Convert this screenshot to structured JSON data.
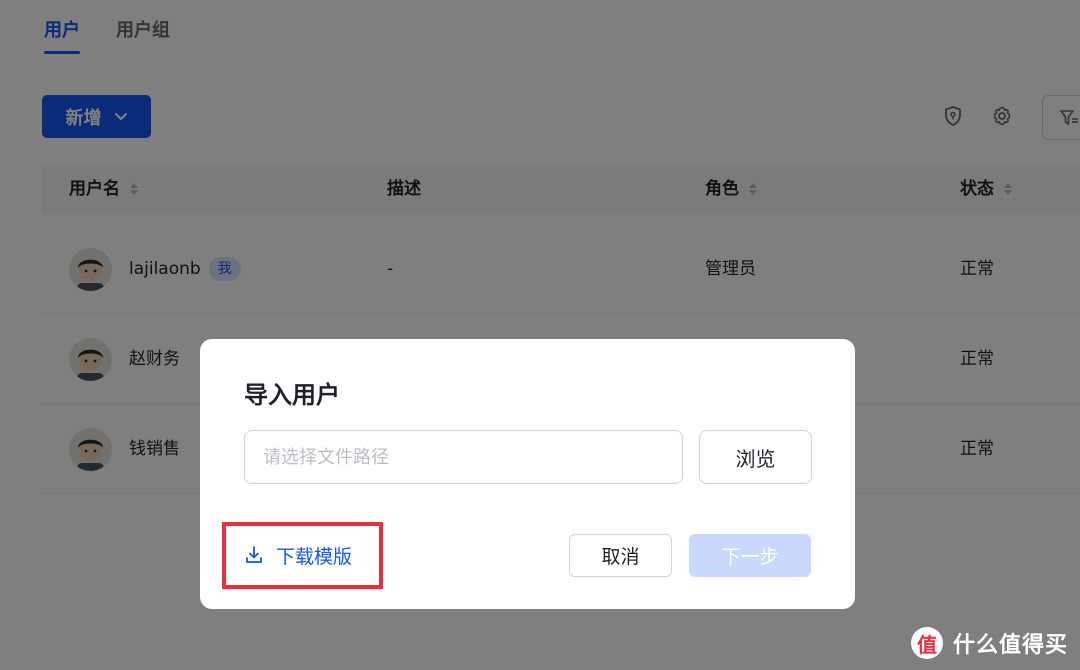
{
  "tabs": [
    {
      "label": "用户"
    },
    {
      "label": "用户组"
    }
  ],
  "toolbar": {
    "add_label": "新增",
    "icons": [
      "shield-icon",
      "gear-icon",
      "filter-icon"
    ]
  },
  "table": {
    "columns": [
      {
        "label": "用户名",
        "sortable": true
      },
      {
        "label": "描述",
        "sortable": false
      },
      {
        "label": "角色",
        "sortable": true
      },
      {
        "label": "状态",
        "sortable": true
      }
    ],
    "rows": [
      {
        "name": "lajilaonb",
        "badge": "我",
        "description": "-",
        "role": "管理员",
        "status": "正常"
      },
      {
        "name": "赵财务",
        "badge": "",
        "description": "",
        "role": "",
        "status": "正常"
      },
      {
        "name": "钱销售",
        "badge": "",
        "description": "",
        "role": "",
        "status": "正常"
      }
    ]
  },
  "modal": {
    "title": "导入用户",
    "input_placeholder": "请选择文件路径",
    "browse_label": "浏览",
    "download_label": "下载模版",
    "cancel_label": "取消",
    "next_label": "下一步"
  },
  "watermark": {
    "logo": "值",
    "text": "什么值得买"
  },
  "colors": {
    "primary": "#1456f0",
    "highlight": "#e8313b",
    "next_disabled": "#c9d9fd"
  }
}
